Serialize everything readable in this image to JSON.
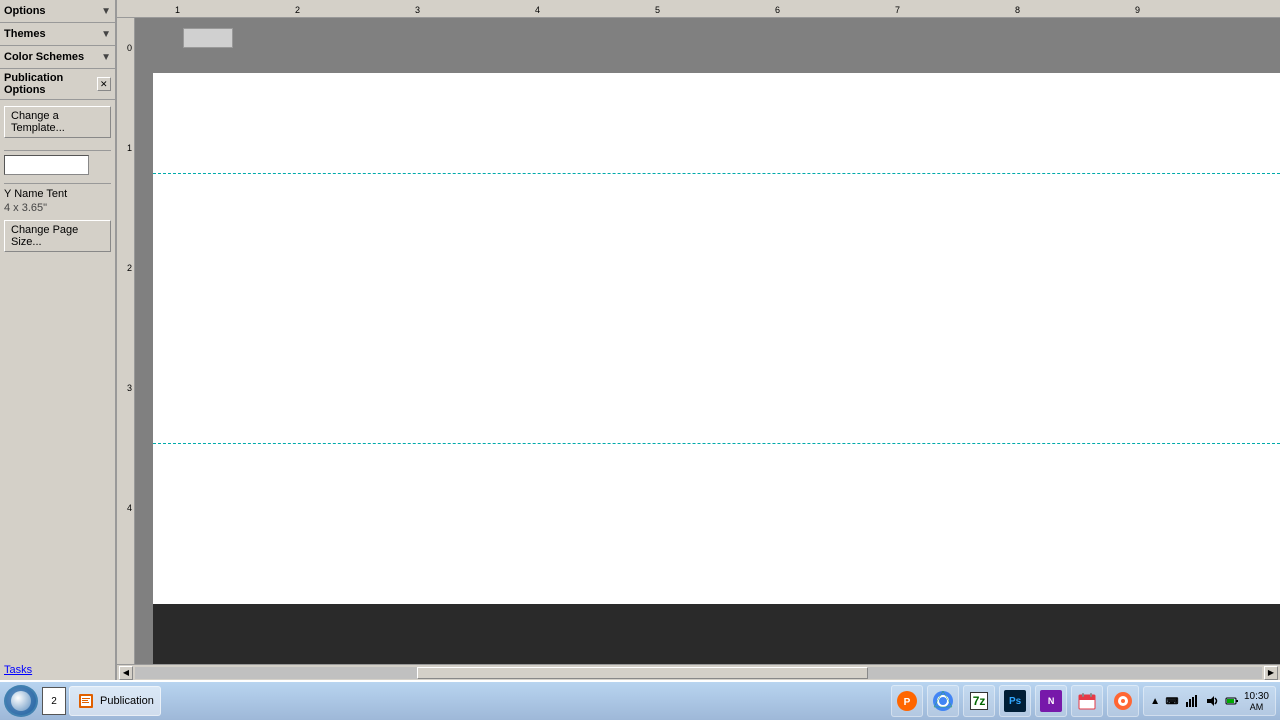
{
  "title": "Publication",
  "title_controls": {
    "minimize": "▼",
    "close": "✕"
  },
  "left_panel": {
    "sections": [
      {
        "id": "options",
        "label": "Options",
        "expanded": true,
        "arrow": "▼"
      },
      {
        "id": "themes",
        "label": "Themes",
        "expanded": false,
        "arrow": "▼"
      },
      {
        "id": "color_schemes",
        "label": "Color Schemes",
        "expanded": false,
        "arrow": "▼"
      }
    ],
    "pub_options": {
      "header": "Publication Options",
      "close_icon": "✕",
      "template_btn": "Change a Template...",
      "template_input_value": "",
      "template_input_placeholder": "",
      "tent_name": "Y Name Tent",
      "tent_size": "4 x 3.65\"",
      "page_size_btn": "Change Page Size..."
    },
    "tasks": {
      "label": "Tasks"
    }
  },
  "canvas": {
    "ruler_numbers_h": [
      "",
      "1",
      "2",
      "3",
      "4",
      "5",
      "6",
      "7",
      "8",
      "9"
    ],
    "ruler_numbers_v": [
      "0",
      "1",
      "2",
      "3",
      "4"
    ],
    "guide_lines": [
      {
        "top_percent": 26
      },
      {
        "top_percent": 82
      }
    ]
  },
  "taskbar": {
    "page_indicator_number": "2",
    "items": [
      {
        "id": "orb",
        "label": ""
      },
      {
        "id": "pub",
        "label": "Publication",
        "active": true,
        "icon": "pub-icon"
      },
      {
        "id": "chrome",
        "label": "",
        "icon": "chrome-icon"
      },
      {
        "id": "7zip",
        "label": "",
        "icon": "7zip-icon"
      },
      {
        "id": "photoshop",
        "label": "",
        "icon": "ps-icon"
      },
      {
        "id": "onenote",
        "label": "",
        "icon": "onenote-icon"
      },
      {
        "id": "calendar",
        "label": "",
        "icon": "calendar-icon"
      },
      {
        "id": "paint",
        "label": "",
        "icon": "paint-icon"
      }
    ],
    "tray": {
      "icons": [
        "network",
        "volume",
        "battery",
        "notification"
      ],
      "time": "▲",
      "keyboard_icon": "⌨"
    }
  }
}
